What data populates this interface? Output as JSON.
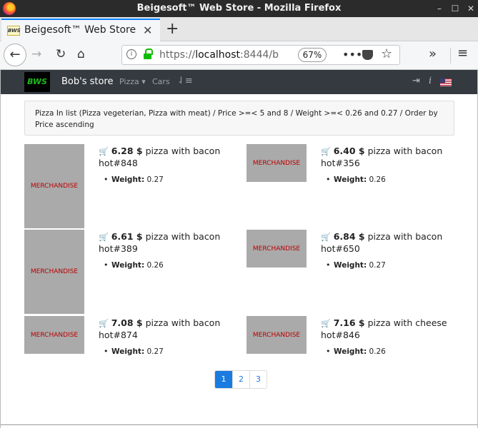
{
  "window": {
    "title": "Beigesoft™ Web Store - Mozilla Firefox",
    "minimize": "–",
    "maximize": "☐",
    "close": "✕"
  },
  "tab": {
    "favicon_text": "BWS",
    "title": "Beigesoft™ Web Store",
    "close": "✕",
    "new_tab": "+"
  },
  "toolbar": {
    "back": "←",
    "forward": "→",
    "reload": "↻",
    "home": "⌂",
    "url_scheme": "https://",
    "url_host": "localhost",
    "url_rest": ":8444/b",
    "zoom": "67%",
    "more": "•••",
    "star": "☆",
    "overflow": "»",
    "menu": "≡"
  },
  "site": {
    "logo_text": "BWS",
    "brand": "Bob's store",
    "nav_pizza": "Pizza ▾",
    "nav_cars": "Cars",
    "nav_sort": "⇃≡",
    "nav_login": "⇥",
    "nav_info": "i"
  },
  "filter": {
    "text": "Pizza In list (Pizza vegeterian, Pizza with meat) / Price >=< 5 and 8 / Weight >=< 0.26 and 0.27 / Order by Price ascending"
  },
  "products": [
    {
      "price": "6.28 $",
      "name": "pizza with bacon hot#848",
      "weight_label": "Weight:",
      "weight": "0.27",
      "image_text": "MERCHANDISE"
    },
    {
      "price": "6.40 $",
      "name": "pizza with bacon hot#356",
      "weight_label": "Weight:",
      "weight": "0.26",
      "image_text": "MERCHANDISE"
    },
    {
      "price": "6.61 $",
      "name": "pizza with bacon hot#389",
      "weight_label": "Weight:",
      "weight": "0.26",
      "image_text": "MERCHANDISE"
    },
    {
      "price": "6.84 $",
      "name": "pizza with bacon hot#650",
      "weight_label": "Weight:",
      "weight": "0.27",
      "image_text": "MERCHANDISE"
    },
    {
      "price": "7.08 $",
      "name": "pizza with bacon hot#874",
      "weight_label": "Weight:",
      "weight": "0.27",
      "image_text": "MERCHANDISE"
    },
    {
      "price": "7.16 $",
      "name": "pizza with cheese hot#846",
      "weight_label": "Weight:",
      "weight": "0.26",
      "image_text": "MERCHANDISE"
    }
  ],
  "cart_icon": "🛒",
  "pagination": {
    "pages": [
      "1",
      "2",
      "3"
    ],
    "current": "1"
  }
}
